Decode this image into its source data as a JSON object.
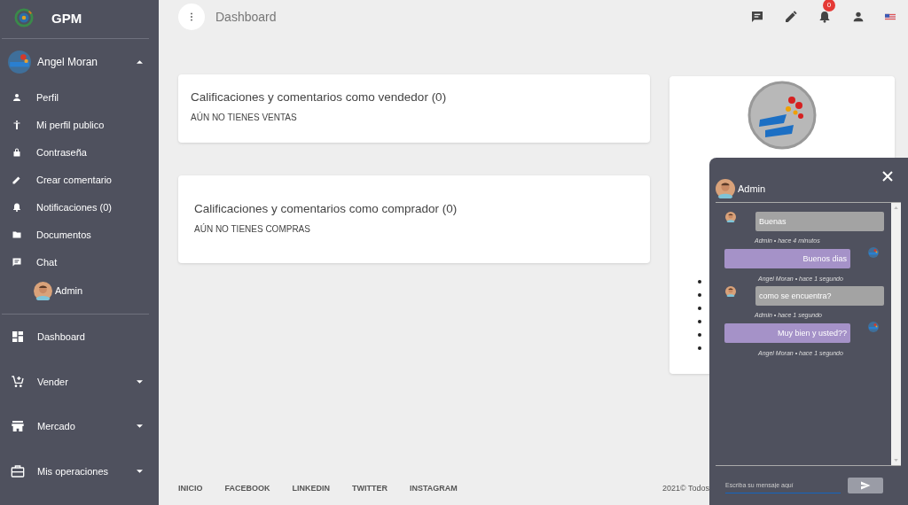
{
  "app": {
    "name": "GPM"
  },
  "user": {
    "name": "Angel Moran",
    "expanded": true
  },
  "profile_menu": [
    {
      "label": "Perfil"
    },
    {
      "label": "Mi perfil publico"
    },
    {
      "label": "Contraseña"
    },
    {
      "label": "Crear comentario"
    },
    {
      "label": "Notificaciones (0)"
    },
    {
      "label": "Documentos"
    },
    {
      "label": "Chat"
    }
  ],
  "chat_contacts": [
    {
      "name": "Admin"
    }
  ],
  "nav": [
    {
      "label": "Dashboard",
      "has_submenu": false
    },
    {
      "label": "Vender",
      "has_submenu": true
    },
    {
      "label": "Mercado",
      "has_submenu": true
    },
    {
      "label": "Mis operaciones",
      "has_submenu": true
    }
  ],
  "topbar": {
    "title": "Dashboard",
    "notification_count": "0"
  },
  "cards": [
    {
      "title": "Calificaciones y comentarios como vendedor (0)",
      "empty_text": "AÚN NO TIENES VENTAS"
    },
    {
      "title": "Calificaciones y comentarios como comprador (0)",
      "empty_text": "AÚN NO TIENES COMPRAS"
    }
  ],
  "footer": {
    "links": [
      "INICIO",
      "FACEBOOK",
      "LINKEDIN",
      "TWITTER",
      "INSTAGRAM"
    ],
    "copyright": "2021© Todos"
  },
  "chat": {
    "title": "Admin",
    "messages": [
      {
        "kind": "received",
        "text": "Buenas",
        "meta": "Admin • hace 4 minutos"
      },
      {
        "kind": "sent",
        "text": "Buenos dias",
        "meta": "Angel Moran • hace 1 segundo"
      },
      {
        "kind": "received",
        "text": "como se encuentra?",
        "meta": "Admin • hace 1 segundo"
      },
      {
        "kind": "sent",
        "text": "Muy bien y usted??",
        "meta": "Angel Moran • hace 1 segundo"
      }
    ],
    "input": {
      "placeholder": "Escriba su mensaje aquí"
    }
  }
}
